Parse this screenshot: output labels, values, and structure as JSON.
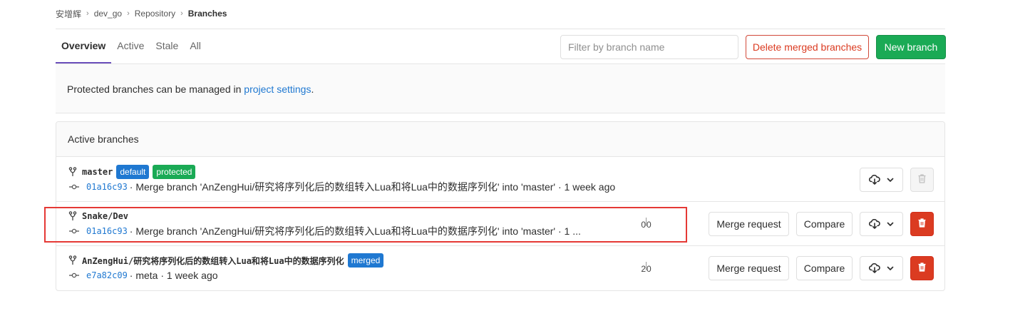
{
  "breadcrumb": {
    "items": [
      "安增辉",
      "dev_go",
      "Repository",
      "Branches"
    ],
    "separator": "›"
  },
  "tabs": [
    "Overview",
    "Active",
    "Stale",
    "All"
  ],
  "active_tab": "Overview",
  "filter": {
    "placeholder": "Filter by branch name",
    "value": ""
  },
  "buttons": {
    "delete_merged": "Delete merged branches",
    "new_branch": "New branch",
    "merge_request": "Merge request",
    "compare": "Compare"
  },
  "notice": {
    "prefix": "Protected branches can be managed in ",
    "link": "project settings",
    "suffix": "."
  },
  "panel": {
    "title": "Active branches"
  },
  "branches": [
    {
      "name": "master",
      "badges": [
        "default",
        "protected"
      ],
      "sha": "01a16c93",
      "commit_text": "· Merge branch 'AnZengHui/研究将序列化后的数组转入Lua和将Lua中的数据序列化' into 'master' · 1 week ago",
      "show_actions": false,
      "delete_enabled": false
    },
    {
      "name": "Snake/Dev",
      "badges": [],
      "sha": "01a16c93",
      "commit_text": "· Merge branch 'AnZengHui/研究将序列化后的数组转入Lua和将Lua中的数据序列化' into 'master' · 1 ...",
      "behind": "0",
      "ahead": "0",
      "show_actions": true,
      "delete_enabled": true
    },
    {
      "name": "AnZengHui/研究将序列化后的数组转入Lua和将Lua中的数据序列化",
      "badges": [
        "merged"
      ],
      "sha": "e7a82c09",
      "commit_text": "· meta · 1 week ago",
      "behind": "2",
      "ahead": "0",
      "show_actions": true,
      "delete_enabled": true
    }
  ],
  "colors": {
    "tab_underline": "#6b4fbb",
    "link": "#1f78d1",
    "success": "#1aaa55",
    "danger": "#db3b21",
    "highlight_box": "#e53935"
  },
  "icons": [
    "branch-icon",
    "commit-icon",
    "cloud-download-icon",
    "chevron-down-icon",
    "trash-icon"
  ]
}
